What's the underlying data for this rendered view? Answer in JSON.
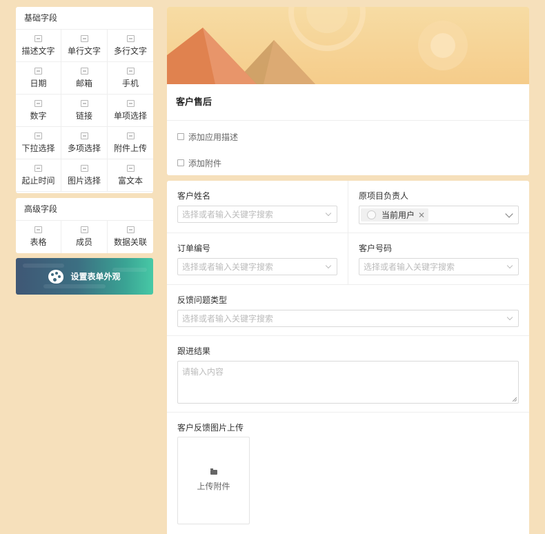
{
  "sidebar": {
    "basic_title": "基础字段",
    "basic_fields": [
      {
        "label": "描述文字",
        "icon": "description-icon"
      },
      {
        "label": "单行文字",
        "icon": "single-line-text-icon"
      },
      {
        "label": "多行文字",
        "icon": "multi-line-text-icon"
      },
      {
        "label": "日期",
        "icon": "calendar-icon"
      },
      {
        "label": "邮箱",
        "icon": "mail-icon"
      },
      {
        "label": "手机",
        "icon": "phone-icon"
      },
      {
        "label": "数字",
        "icon": "number-icon"
      },
      {
        "label": "链接",
        "icon": "link-icon"
      },
      {
        "label": "单项选择",
        "icon": "radio-icon"
      },
      {
        "label": "下拉选择",
        "icon": "dropdown-icon"
      },
      {
        "label": "多项选择",
        "icon": "checkbox-icon"
      },
      {
        "label": "附件上传",
        "icon": "attachment-icon"
      },
      {
        "label": "起止时间",
        "icon": "clock-icon"
      },
      {
        "label": "图片选择",
        "icon": "image-icon"
      },
      {
        "label": "富文本",
        "icon": "rich-text-icon"
      }
    ],
    "advanced_title": "高级字段",
    "advanced_fields": [
      {
        "label": "表格",
        "icon": "table-icon"
      },
      {
        "label": "成员",
        "icon": "member-icon"
      },
      {
        "label": "数据关联",
        "icon": "data-link-icon"
      }
    ],
    "appearance_button": "设置表单外观"
  },
  "header": {
    "app_title": "客户售后",
    "add_description": "添加应用描述",
    "add_attachment": "添加附件"
  },
  "form": {
    "customer_name": {
      "label": "客户姓名",
      "placeholder": "选择或者输入关键字搜索"
    },
    "project_owner": {
      "label": "原项目负责人",
      "tag": "当前用户"
    },
    "order_number": {
      "label": "订单编号",
      "placeholder": "选择或者输入关键字搜索"
    },
    "customer_phone": {
      "label": "客户号码",
      "placeholder": "选择或者输入关键字搜索"
    },
    "issue_type": {
      "label": "反馈问题类型",
      "placeholder": "选择或者输入关键字搜索"
    },
    "follow_up": {
      "label": "跟进结果",
      "placeholder": "请输入内容"
    },
    "image_upload": {
      "label": "客户反馈图片上传",
      "button": "上传附件"
    }
  },
  "colors": {
    "page_bg": "#f6e0bb",
    "banner_top": "#f7dca4",
    "banner_pyramid_left": "#e58d5e",
    "banner_pyramid_right": "#d9a26a",
    "appearance_gradient_start": "#3f5775",
    "appearance_gradient_end": "#47c9a6"
  }
}
